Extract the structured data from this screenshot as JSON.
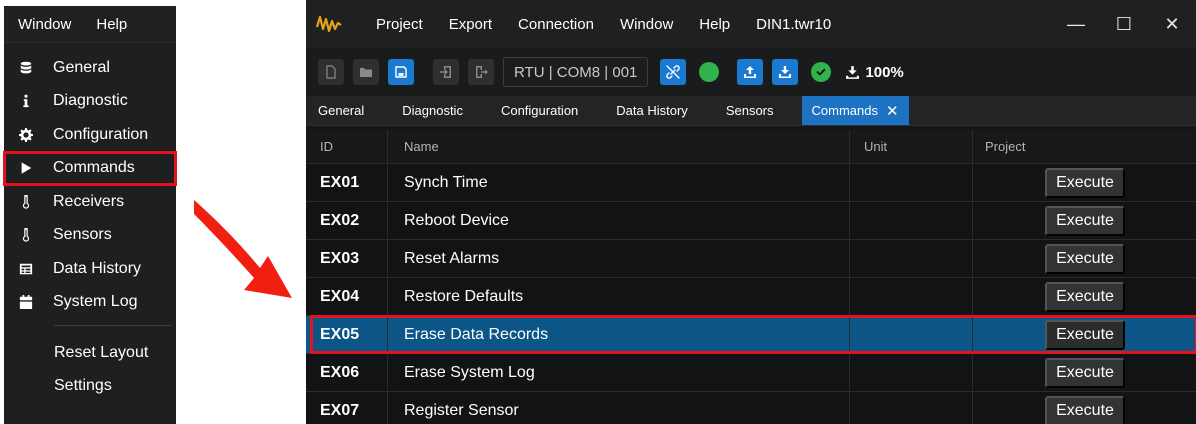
{
  "left_panel": {
    "menubar": [
      "Window",
      "Help"
    ],
    "items": [
      {
        "label": "General",
        "icon": "database-icon",
        "active": false
      },
      {
        "label": "Diagnostic",
        "icon": "info-icon",
        "active": false
      },
      {
        "label": "Configuration",
        "icon": "gear-icon",
        "active": false
      },
      {
        "label": "Commands",
        "icon": "play-icon",
        "active": true
      },
      {
        "label": "Receivers",
        "icon": "thermometer-icon",
        "active": false
      },
      {
        "label": "Sensors",
        "icon": "thermometer-icon",
        "active": false
      },
      {
        "label": "Data History",
        "icon": "table-icon",
        "active": false
      },
      {
        "label": "System Log",
        "icon": "calendar-icon",
        "active": false
      }
    ],
    "footer_items": [
      "Reset Layout",
      "Settings"
    ]
  },
  "titlebar": {
    "menu": [
      "Project",
      "Export",
      "Connection",
      "Window",
      "Help"
    ],
    "file_name": "DIN1.twr10",
    "controls": [
      "minimize",
      "maximize",
      "close"
    ]
  },
  "toolbar": {
    "port_display": "RTU | COM8 | 001",
    "progress": "100%"
  },
  "tabs": [
    {
      "label": "General",
      "active": false
    },
    {
      "label": "Diagnostic",
      "active": false
    },
    {
      "label": "Configuration",
      "active": false
    },
    {
      "label": "Data History",
      "active": false
    },
    {
      "label": "Sensors",
      "active": false
    },
    {
      "label": "Commands",
      "active": true
    }
  ],
  "table": {
    "headers": {
      "id": "ID",
      "name": "Name",
      "unit": "Unit",
      "project": "Project"
    },
    "rows": [
      {
        "id": "EX01",
        "name": "Synch Time",
        "unit": "",
        "action": "Execute",
        "selected": false
      },
      {
        "id": "EX02",
        "name": "Reboot Device",
        "unit": "",
        "action": "Execute",
        "selected": false
      },
      {
        "id": "EX03",
        "name": "Reset Alarms",
        "unit": "",
        "action": "Execute",
        "selected": false
      },
      {
        "id": "EX04",
        "name": "Restore Defaults",
        "unit": "",
        "action": "Execute",
        "selected": false
      },
      {
        "id": "EX05",
        "name": "Erase Data Records",
        "unit": "",
        "action": "Execute",
        "selected": true
      },
      {
        "id": "EX06",
        "name": "Erase System Log",
        "unit": "",
        "action": "Execute",
        "selected": false
      },
      {
        "id": "EX07",
        "name": "Register Sensor",
        "unit": "",
        "action": "Execute",
        "selected": false
      }
    ]
  },
  "colors": {
    "highlight_red": "#e3121b",
    "accent_blue": "#1d73c2",
    "selected_row": "#0b5687",
    "status_green": "#2fb34a"
  }
}
